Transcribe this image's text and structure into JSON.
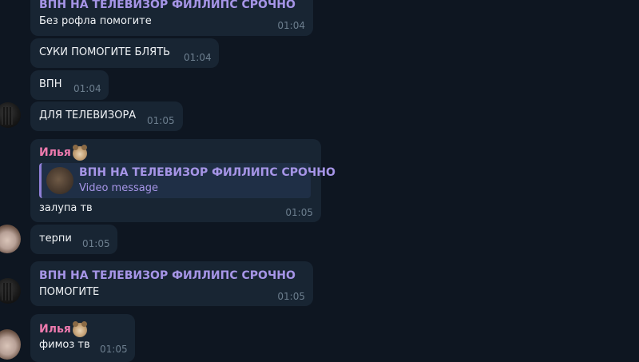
{
  "messages": [
    {
      "sender": "ВПН НА ТЕЛЕВИЗОР ФИЛЛИПС СРОЧНО",
      "text": "Без рофла помогите",
      "time": "01:04"
    },
    {
      "text": "СУКИ ПОМОГИТЕ БЛЯТЬ",
      "time": "01:04"
    },
    {
      "text": "ВПН",
      "time": "01:04"
    },
    {
      "text": "ДЛЯ ТЕЛЕВИЗОРА",
      "time": "01:05"
    },
    {
      "sender": "Илья",
      "reply": {
        "title": "ВПН НА ТЕЛЕВИЗОР ФИЛЛИПС СРОЧНО",
        "subtitle": "Video message"
      },
      "text": "залупа тв",
      "time": "01:05"
    },
    {
      "text": "терпи",
      "time": "01:05"
    },
    {
      "sender": "ВПН НА ТЕЛЕВИЗОР ФИЛЛИПС СРОЧНО",
      "text": "ПОМОГИТЕ",
      "time": "01:05"
    },
    {
      "sender": "Илья",
      "text": "фимоз тв",
      "time": "01:05"
    }
  ],
  "colors": {
    "background": "#0e1621",
    "bubble": "#182533",
    "name_purple": "#a695e7",
    "name_pink": "#ee7aae",
    "time": "#6d7f8f"
  },
  "icons": [
    "user-avatar-dark",
    "user-avatar-photo",
    "bear-emoji-icon"
  ]
}
